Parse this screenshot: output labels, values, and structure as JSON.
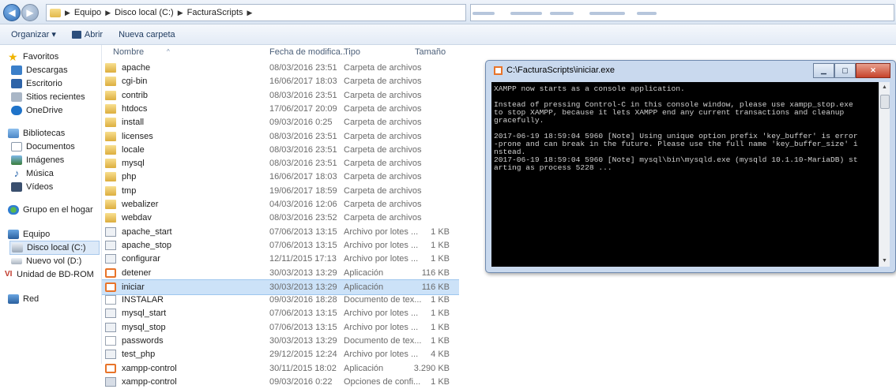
{
  "breadcrumb": {
    "items": [
      "Equipo",
      "Disco local (C:)",
      "FacturaScripts"
    ]
  },
  "toolbar": {
    "organize": "Organizar ▾",
    "open": "Abrir",
    "new_folder": "Nueva carpeta"
  },
  "nav": {
    "favorites": "Favoritos",
    "descargas": "Descargas",
    "escritorio": "Escritorio",
    "sitios": "Sitios recientes",
    "onedrive": "OneDrive",
    "bibliotecas": "Bibliotecas",
    "documentos": "Documentos",
    "imagenes": "Imágenes",
    "musica": "Música",
    "videos": "Vídeos",
    "grupo": "Grupo en el hogar",
    "equipo": "Equipo",
    "disco_c": "Disco local (C:)",
    "nuevo_vol": "Nuevo vol (D:)",
    "bdrom": "Unidad de BD-ROM",
    "red": "Red"
  },
  "columns": {
    "name": "Nombre",
    "date": "Fecha de modifica...",
    "type": "Tipo",
    "size": "Tamaño"
  },
  "files": [
    {
      "name": "apache",
      "date": "08/03/2016 23:51",
      "type": "Carpeta de archivos",
      "size": "",
      "icon": "folder"
    },
    {
      "name": "cgi-bin",
      "date": "16/06/2017 18:03",
      "type": "Carpeta de archivos",
      "size": "",
      "icon": "folder"
    },
    {
      "name": "contrib",
      "date": "08/03/2016 23:51",
      "type": "Carpeta de archivos",
      "size": "",
      "icon": "folder"
    },
    {
      "name": "htdocs",
      "date": "17/06/2017 20:09",
      "type": "Carpeta de archivos",
      "size": "",
      "icon": "folder"
    },
    {
      "name": "install",
      "date": "09/03/2016 0:25",
      "type": "Carpeta de archivos",
      "size": "",
      "icon": "folder"
    },
    {
      "name": "licenses",
      "date": "08/03/2016 23:51",
      "type": "Carpeta de archivos",
      "size": "",
      "icon": "folder"
    },
    {
      "name": "locale",
      "date": "08/03/2016 23:51",
      "type": "Carpeta de archivos",
      "size": "",
      "icon": "folder"
    },
    {
      "name": "mysql",
      "date": "08/03/2016 23:51",
      "type": "Carpeta de archivos",
      "size": "",
      "icon": "folder"
    },
    {
      "name": "php",
      "date": "16/06/2017 18:03",
      "type": "Carpeta de archivos",
      "size": "",
      "icon": "folder"
    },
    {
      "name": "tmp",
      "date": "19/06/2017 18:59",
      "type": "Carpeta de archivos",
      "size": "",
      "icon": "folder"
    },
    {
      "name": "webalizer",
      "date": "04/03/2016 12:06",
      "type": "Carpeta de archivos",
      "size": "",
      "icon": "folder"
    },
    {
      "name": "webdav",
      "date": "08/03/2016 23:52",
      "type": "Carpeta de archivos",
      "size": "",
      "icon": "folder"
    },
    {
      "name": "apache_start",
      "date": "07/06/2013 13:15",
      "type": "Archivo por lotes ...",
      "size": "1 KB",
      "icon": "batch"
    },
    {
      "name": "apache_stop",
      "date": "07/06/2013 13:15",
      "type": "Archivo por lotes ...",
      "size": "1 KB",
      "icon": "batch"
    },
    {
      "name": "configurar",
      "date": "12/11/2015 17:13",
      "type": "Archivo por lotes ...",
      "size": "1 KB",
      "icon": "batch"
    },
    {
      "name": "detener",
      "date": "30/03/2013 13:29",
      "type": "Aplicación",
      "size": "116 KB",
      "icon": "app"
    },
    {
      "name": "iniciar",
      "date": "30/03/2013 13:29",
      "type": "Aplicación",
      "size": "116 KB",
      "icon": "app"
    },
    {
      "name": "INSTALAR",
      "date": "09/03/2016 18:28",
      "type": "Documento de tex...",
      "size": "1 KB",
      "icon": "doc"
    },
    {
      "name": "mysql_start",
      "date": "07/06/2013 13:15",
      "type": "Archivo por lotes ...",
      "size": "1 KB",
      "icon": "batch"
    },
    {
      "name": "mysql_stop",
      "date": "07/06/2013 13:15",
      "type": "Archivo por lotes ...",
      "size": "1 KB",
      "icon": "batch"
    },
    {
      "name": "passwords",
      "date": "30/03/2013 13:29",
      "type": "Documento de tex...",
      "size": "1 KB",
      "icon": "doc"
    },
    {
      "name": "test_php",
      "date": "29/12/2015 12:24",
      "type": "Archivo por lotes ...",
      "size": "4 KB",
      "icon": "batch"
    },
    {
      "name": "xampp-control",
      "date": "30/11/2015 18:02",
      "type": "Aplicación",
      "size": "3.290 KB",
      "icon": "app"
    },
    {
      "name": "xampp-control",
      "date": "09/03/2016 0:22",
      "type": "Opciones de confi...",
      "size": "1 KB",
      "icon": "config"
    }
  ],
  "selected_file": "iniciar",
  "console": {
    "title": "C:\\FacturaScripts\\iniciar.exe",
    "text": "XAMPP now starts as a console application.\n\nInstead of pressing Control-C in this console window, please use xampp_stop.exe\nto stop XAMPP, because it lets XAMPP end any current transactions and cleanup\ngracefully.\n\n2017-06-19 18:59:04 5960 [Note] Using unique option prefix 'key_buffer' is error\n-prone and can break in the future. Please use the full name 'key_buffer_size' i\nnstead.\n2017-06-19 18:59:04 5960 [Note] mysql\\bin\\mysqld.exe (mysqld 10.1.10-MariaDB) st\narting as process 5228 ..."
  },
  "colors": {
    "selection": "#cce2f8",
    "console_bg": "#000000",
    "console_fg": "#d0d0d0",
    "window_frame": "#c9d9ee"
  }
}
